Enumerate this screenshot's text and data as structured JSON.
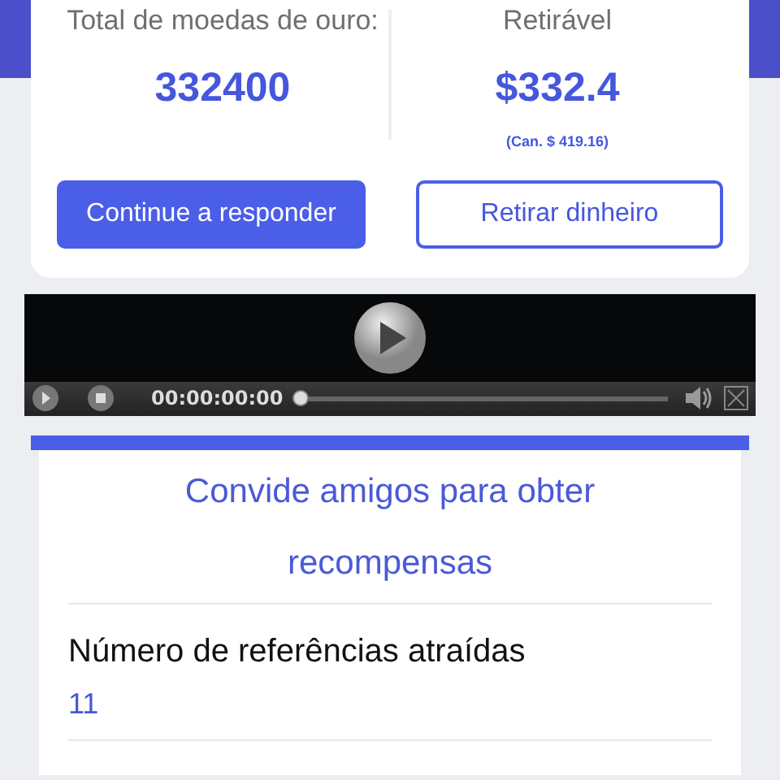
{
  "balance": {
    "gold_label": "Total de moedas de ouro:",
    "gold_value": "332400",
    "withdrawable_label": "Retirável",
    "withdrawable_value": "$332.4",
    "converted_value": "(Can. $ 419.16)"
  },
  "buttons": [
    {
      "label": "Continue a responder",
      "kind": "primary"
    },
    {
      "label": "Retirar dinheiro",
      "kind": "outline"
    }
  ],
  "video_player": {
    "time": "00:00:00:00",
    "level": 0
  },
  "referral": {
    "title": "Convide amigos para obter recompensas",
    "stats": [
      {
        "label": "Número de referências atraídas",
        "value": "11"
      }
    ]
  }
}
